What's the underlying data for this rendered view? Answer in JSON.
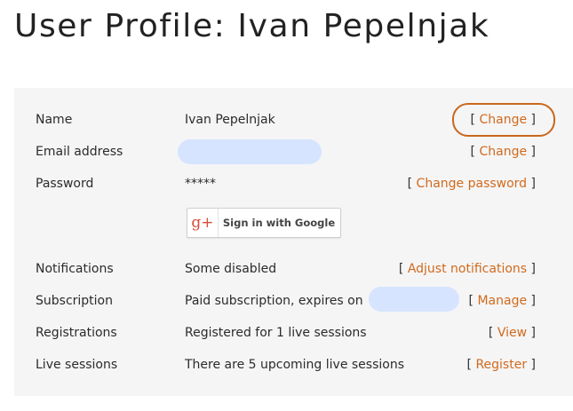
{
  "page": {
    "title": "User Profile: Ivan Pepelnjak"
  },
  "profile": {
    "name": {
      "label": "Name",
      "value": "Ivan Pepelnjak",
      "action": "Change"
    },
    "email": {
      "label": "Email address",
      "value": "",
      "action": "Change"
    },
    "password": {
      "label": "Password",
      "value": "*****",
      "action": "Change password"
    },
    "google": {
      "button_label": "Sign in with Google",
      "icon_text": "g+"
    },
    "notifications": {
      "label": "Notifications",
      "value": "Some disabled",
      "action": "Adjust notifications"
    },
    "subscription": {
      "label": "Subscription",
      "value": "Paid subscription, expires on",
      "action": "Manage"
    },
    "registrations": {
      "label": "Registrations",
      "value": "Registered for 1 live sessions",
      "action": "View"
    },
    "live_sessions": {
      "label": "Live sessions",
      "value": "There are 5 upcoming live sessions",
      "action": "Register"
    }
  },
  "colors": {
    "link": "#d06a1e",
    "panel_background": "#f5f5f5",
    "redaction": "#d6e4ff",
    "google_red": "#dd4b39"
  }
}
